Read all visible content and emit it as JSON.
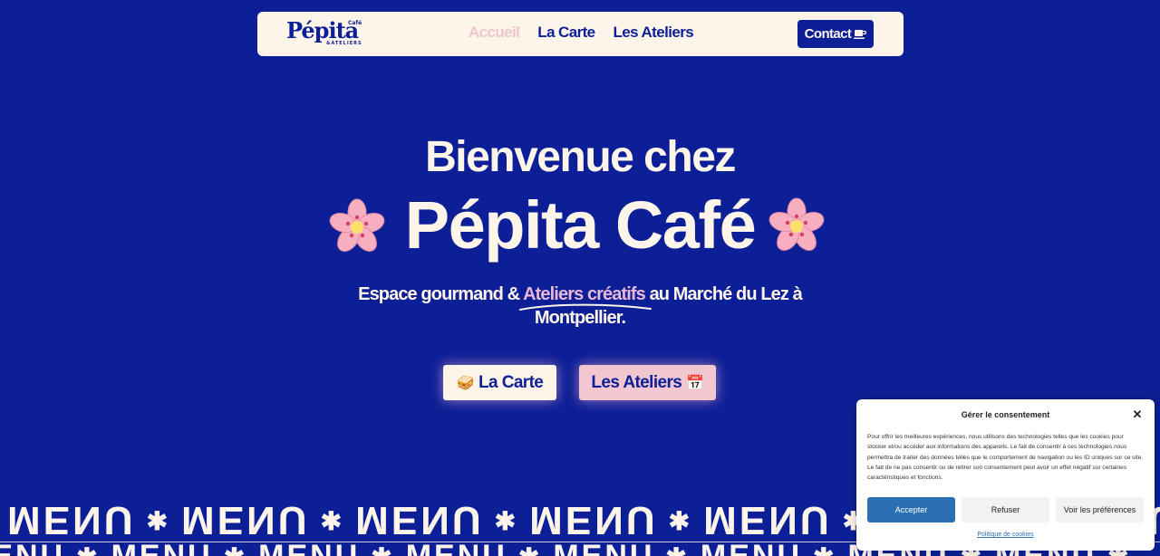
{
  "nav": {
    "logo": {
      "main": "Pépita",
      "cafe": "Café",
      "sub": "&ATELIERS"
    },
    "links": [
      {
        "label": "Accueil",
        "active": true
      },
      {
        "label": "La Carte",
        "active": false
      },
      {
        "label": "Les Ateliers",
        "active": false
      }
    ],
    "contact_label": "Contact"
  },
  "hero": {
    "line1": "Bienvenue chez",
    "line2": "Pépita Café",
    "tagline_before": "Espace gourmand & ",
    "tagline_highlight": "Ateliers créatifs",
    "tagline_after": " au Marché du Lez à Montpellier.",
    "btn_carte": {
      "label": "La Carte",
      "emoji": "🥪"
    },
    "btn_ateliers": {
      "label": "Les Ateliers",
      "emoji": "📅"
    }
  },
  "marquee": {
    "word": "MENU",
    "star": "✱"
  },
  "consent": {
    "title": "Gérer le consentement",
    "text": "Pour offrir les meilleures expériences, nous utilisons des technologies telles que les cookies pour stocker et/ou accéder aux informations des appareils. Le fait de consentir à ces technologies nous permettra de traiter des données telles que le comportement de navigation ou les ID uniques sur ce site. Le fait de ne pas consentir ou de retirer son consentement peut avoir un effet négatif sur certaines caractéristiques et fonctions.",
    "accept": "Accepter",
    "refuse": "Refuser",
    "prefs": "Voir les préférences",
    "policy": "Politique de cookies"
  },
  "colors": {
    "background": "#0c1f96",
    "cream": "#fdf4ea",
    "pink": "#f3c7cf",
    "highlight": "#e7b8d8",
    "consent_blue": "#2d6fb3"
  }
}
